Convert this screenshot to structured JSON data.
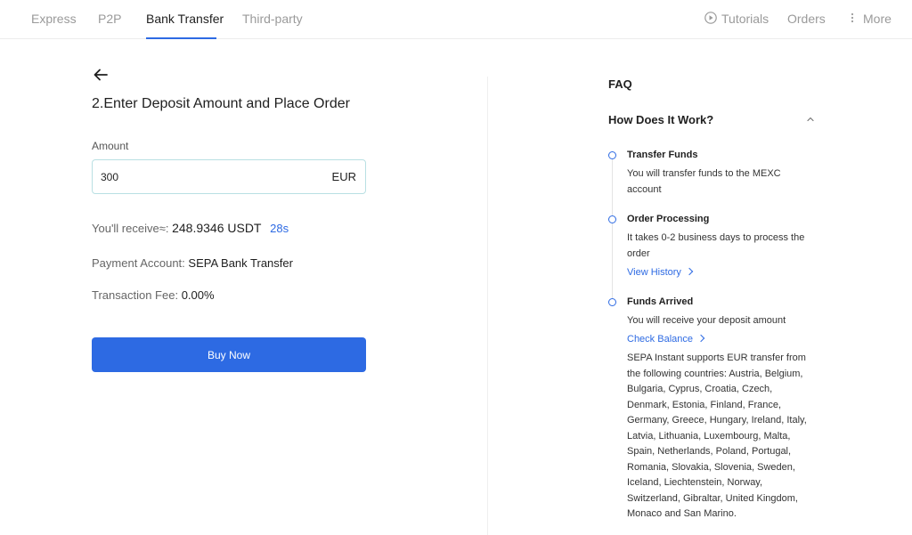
{
  "nav": {
    "tabs": [
      {
        "label": "Express"
      },
      {
        "label": "P2P"
      },
      {
        "label": "Bank Transfer"
      },
      {
        "label": "Third-party"
      }
    ],
    "active_tab": "Bank Transfer",
    "tutorials_label": "Tutorials",
    "orders_label": "Orders",
    "more_label": "More"
  },
  "form": {
    "title": "2.Enter Deposit Amount and Place Order",
    "amount_label": "Amount",
    "amount_value": "300",
    "currency": "EUR",
    "receive_label": "You'll receive≈:",
    "receive_value": "248.9346 USDT",
    "countdown": "28s",
    "payment_label": "Payment Account:",
    "payment_value": "SEPA Bank Transfer",
    "fee_label": "Transaction Fee:",
    "fee_value": "0.00%",
    "buy_label": "Buy Now"
  },
  "faq": {
    "title": "FAQ",
    "question": "How Does It Work?",
    "steps": [
      {
        "title": "Transfer Funds",
        "desc": "You will transfer funds to the MEXC account"
      },
      {
        "title": "Order Processing",
        "desc": "It takes 0-2 business days to process the order",
        "link": "View History"
      },
      {
        "title": "Funds Arrived",
        "desc": "You will receive your deposit amount",
        "link": "Check Balance"
      }
    ],
    "sepa_note": "SEPA Instant supports EUR transfer from the following countries: Austria, Belgium, Bulgaria, Cyprus, Croatia, Czech, Denmark, Estonia, Finland, France, Germany, Greece, Hungary, Ireland, Italy, Latvia, Lithuania, Luxembourg, Malta, Spain, Netherlands, Poland, Portugal, Romania, Slovakia, Slovenia, Sweden, Iceland, Liechtenstein, Norway, Switzerland, Gibraltar, United Kingdom, Monaco and San Marino."
  },
  "colors": {
    "accent": "#2d6ae3",
    "input_border": "#b9e0e3"
  },
  "icons": [
    "play-circle-icon",
    "more-vertical-icon",
    "arrow-left-icon",
    "chevron-up-icon",
    "chevron-right-icon"
  ]
}
